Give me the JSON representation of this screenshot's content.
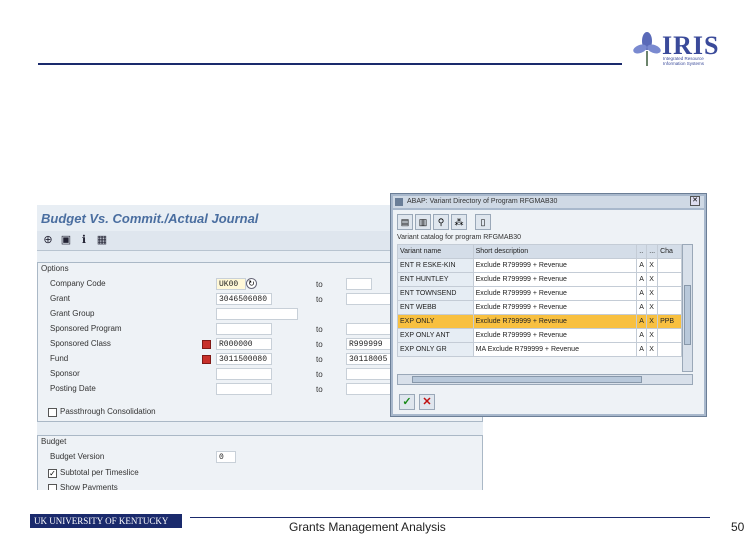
{
  "header": {
    "logo_text": "IRIS",
    "logo_sub": "Integrated Resource Information Systems"
  },
  "sap": {
    "title": "Budget Vs. Commit./Actual Journal",
    "options_title": "Options",
    "rows": [
      {
        "label": "Company Code",
        "from": "UK00",
        "to_label": "to",
        "to": ""
      },
      {
        "label": "Grant",
        "from": "3046506080",
        "to_label": "to",
        "to": ""
      },
      {
        "label": "Grant Group",
        "from": "",
        "to_label": "",
        "to": ""
      },
      {
        "label": "Sponsored Program",
        "from": "",
        "to_label": "to",
        "to": ""
      },
      {
        "label": "Sponsored Class",
        "from": "R000000",
        "to_label": "to",
        "to": "R999999"
      },
      {
        "label": "Fund",
        "from": "3011500080",
        "to_label": "to",
        "to": "30118005"
      },
      {
        "label": "Sponsor",
        "from": "",
        "to_label": "to",
        "to": ""
      },
      {
        "label": "Posting Date",
        "from": "",
        "to_label": "to",
        "to": ""
      }
    ],
    "passthrough_label": "Passthrough Consolidation",
    "budget_title": "Budget",
    "budget_version_label": "Budget Version",
    "budget_version_value": "0",
    "subtotal_label": "Subtotal per Timeslice",
    "show_payments_label": "Show Payments"
  },
  "popup": {
    "title": "ABAP: Variant Directory of Program RFGMAB30",
    "subtitle": "Variant catalog for program RFGMAB30",
    "columns": [
      "Variant name",
      "Short description",
      "..",
      "...",
      "Cha"
    ],
    "rows": [
      {
        "name": "ENT R ESKE-KIN",
        "desc": "Exclude R799999 + Revenue",
        "a": "A",
        "x": "X",
        "c": "",
        "selected": false
      },
      {
        "name": "ENT HUNTLEY",
        "desc": "Exclude R799999 + Revenue",
        "a": "A",
        "x": "X",
        "c": "",
        "selected": false
      },
      {
        "name": "ENT TOWNSEND",
        "desc": "Exclude R799999 + Revenue",
        "a": "A",
        "x": "X",
        "c": "",
        "selected": false
      },
      {
        "name": "ENT WEBB",
        "desc": "Exclude R799999 + Revenue",
        "a": "A",
        "x": "X",
        "c": "",
        "selected": false
      },
      {
        "name": "EXP ONLY",
        "desc": "Exclude R799999 + Revenue",
        "a": "A",
        "x": "X",
        "c": "PPB",
        "selected": true
      },
      {
        "name": "EXP ONLY ANT",
        "desc": "Exclude R799999 + Revenue",
        "a": "A",
        "x": "X",
        "c": "",
        "selected": false
      },
      {
        "name": "EXP ONLY GR",
        "desc": "MA Exclude R799999 + Revenue",
        "a": "A",
        "x": "X",
        "c": "",
        "selected": false
      }
    ]
  },
  "footer": {
    "uk_logo": "UK UNIVERSITY OF KENTUCKY",
    "title": "Grants Management Analysis",
    "page": "50"
  }
}
